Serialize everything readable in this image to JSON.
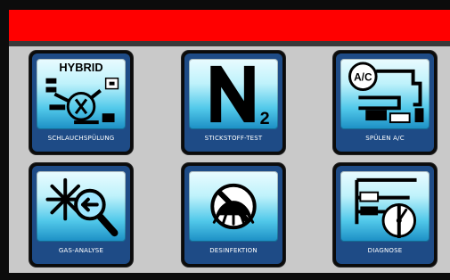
{
  "tiles": [
    {
      "label": "SCHLAUCHSPÜLUNG",
      "icon": "hybrid-hose-flush-icon",
      "icon_text": "HYBRID"
    },
    {
      "label": "STICKSTOFF-TEST",
      "icon": "nitrogen-n2-icon"
    },
    {
      "label": "SPÜLEN A/C",
      "icon": "ac-flush-icon",
      "icon_text": "A/C"
    },
    {
      "label": "GAS-ANALYSE",
      "icon": "gas-analysis-icon"
    },
    {
      "label": "DESINFEKTION",
      "icon": "no-bacteria-disinfection-icon"
    },
    {
      "label": "DIAGNOSE",
      "icon": "diagnosis-gauge-icon"
    }
  ],
  "colors": {
    "header": "#ff0000",
    "panel": "#c9c9c9",
    "tile_border": "#0b0b0b",
    "tile_label_bg": "#1e4b86",
    "icon_gradient_bottom": "#1b8ec4"
  }
}
